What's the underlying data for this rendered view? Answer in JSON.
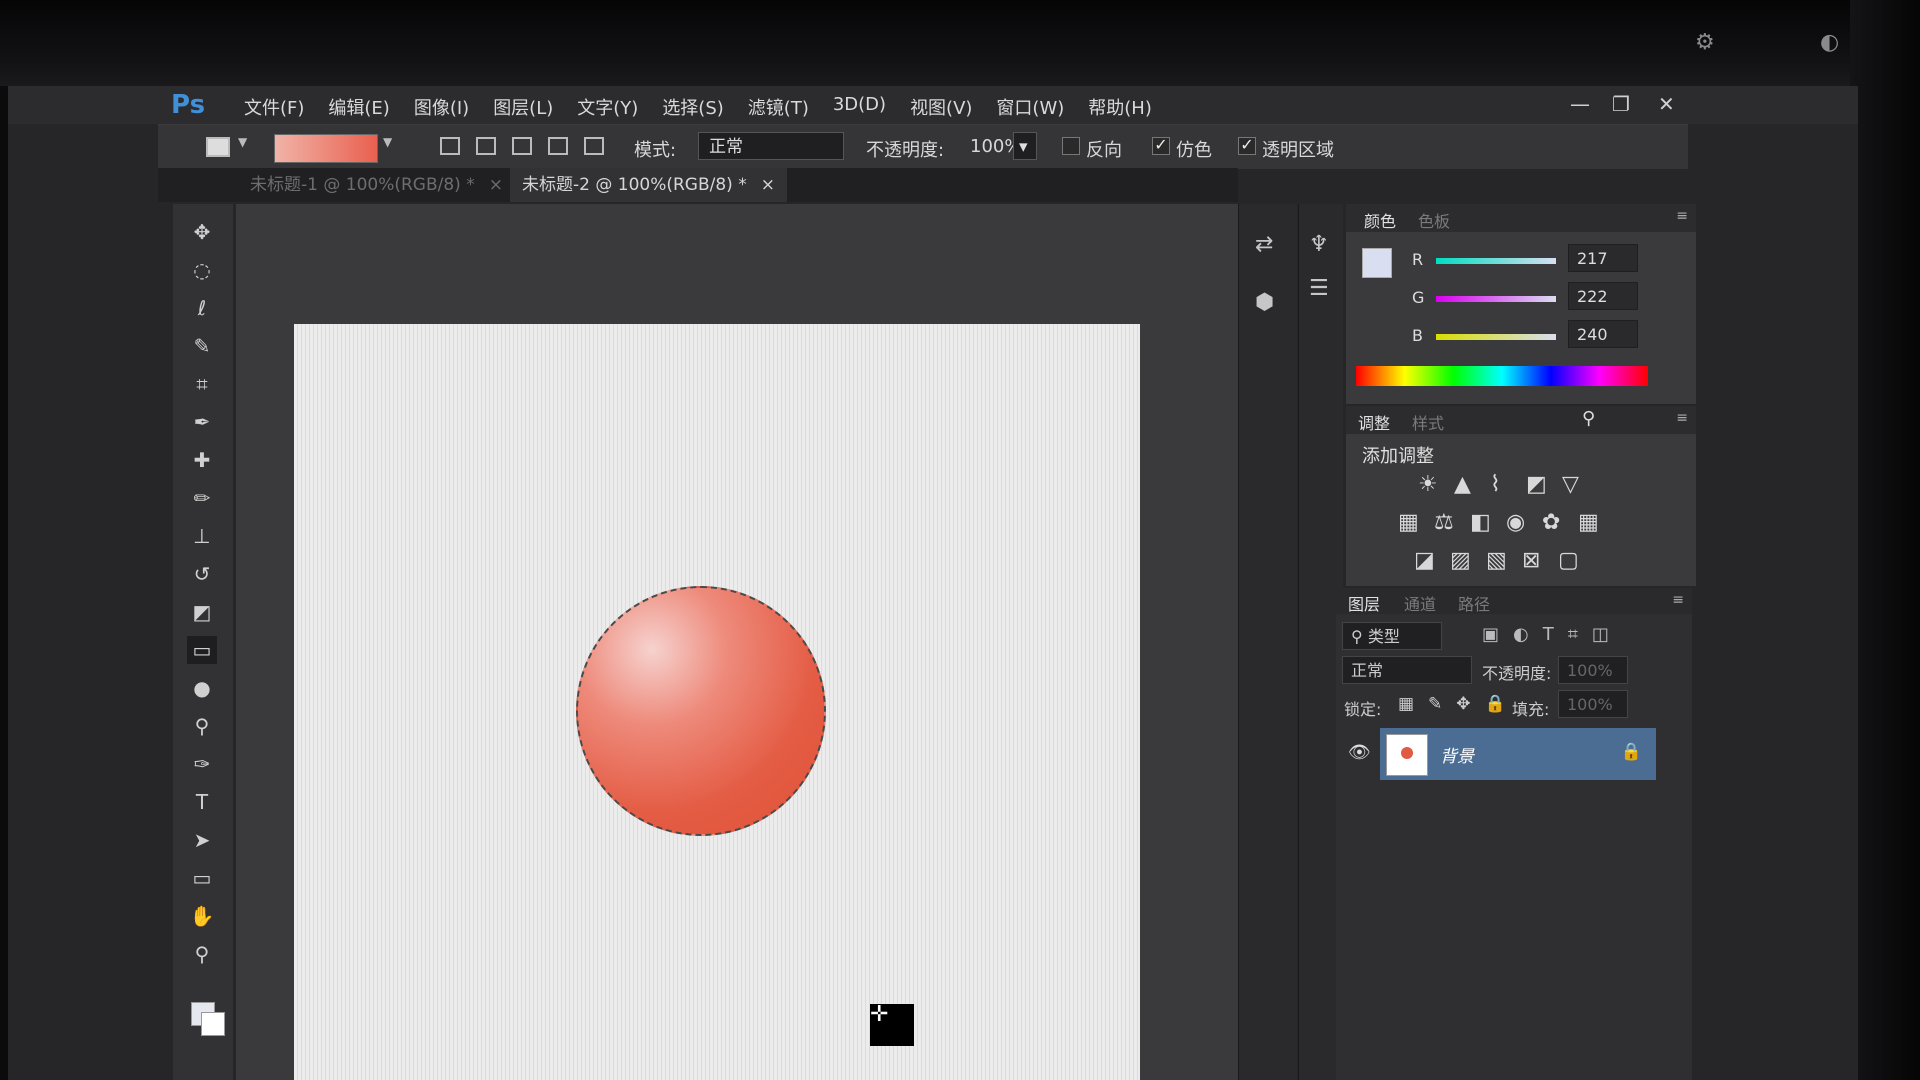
{
  "app": {
    "logo": "Ps"
  },
  "menus": [
    "文件(F)",
    "编辑(E)",
    "图像(I)",
    "图层(L)",
    "文字(Y)",
    "选择(S)",
    "滤镜(T)",
    "3D(D)",
    "视图(V)",
    "窗口(W)",
    "帮助(H)"
  ],
  "window_controls": {
    "minimize": "—",
    "restore": "❐",
    "close": "✕"
  },
  "options": {
    "mode_label": "模式:",
    "mode_value": "正常",
    "opacity_label": "不透明度:",
    "opacity_value": "100%",
    "reverse_label": "反向",
    "reverse_checked": false,
    "dither_label": "仿色",
    "dither_checked": true,
    "transparency_label": "透明区域",
    "transparency_checked": true,
    "gradient_colors": [
      "#f1b3a8",
      "#e9604f"
    ]
  },
  "tabs": [
    {
      "label": "未标题-1 @ 100%(RGB/8) *",
      "active": false
    },
    {
      "label": "未标题-2 @ 100%(RGB/8) *",
      "active": true
    }
  ],
  "tab_close": "×",
  "tools": [
    "move-icon",
    "ellipse-marquee-icon",
    "lasso-icon",
    "quick-select-icon",
    "crop-icon",
    "eyedropper-icon",
    "healing-brush-icon",
    "brush-icon",
    "clone-stamp-icon",
    "history-brush-icon",
    "eraser-icon",
    "gradient-icon",
    "blur-icon",
    "dodge-icon",
    "pen-icon",
    "type-icon",
    "path-select-icon",
    "rectangle-icon",
    "hand-icon",
    "zoom-icon"
  ],
  "colors": {
    "foreground": "#d9def0",
    "background": "#ffffff",
    "selection_fill": "#e45c44"
  },
  "color_panel": {
    "tabs": [
      "颜色",
      "色板"
    ],
    "channels": [
      {
        "name": "R",
        "value": "217"
      },
      {
        "name": "G",
        "value": "222"
      },
      {
        "name": "B",
        "value": "240"
      }
    ]
  },
  "adjust_panel": {
    "tabs": [
      "调整",
      "样式"
    ],
    "heading": "添加调整"
  },
  "layers_panel": {
    "tabs": [
      "图层",
      "通道",
      "路径"
    ],
    "filter_label": "类型",
    "blend_mode": "正常",
    "opacity_label": "不透明度:",
    "opacity_value": "100%",
    "lock_label": "锁定:",
    "fill_label": "填充:",
    "fill_value": "100%",
    "layers": [
      {
        "name": "背景",
        "visible": true,
        "locked": true
      }
    ]
  }
}
